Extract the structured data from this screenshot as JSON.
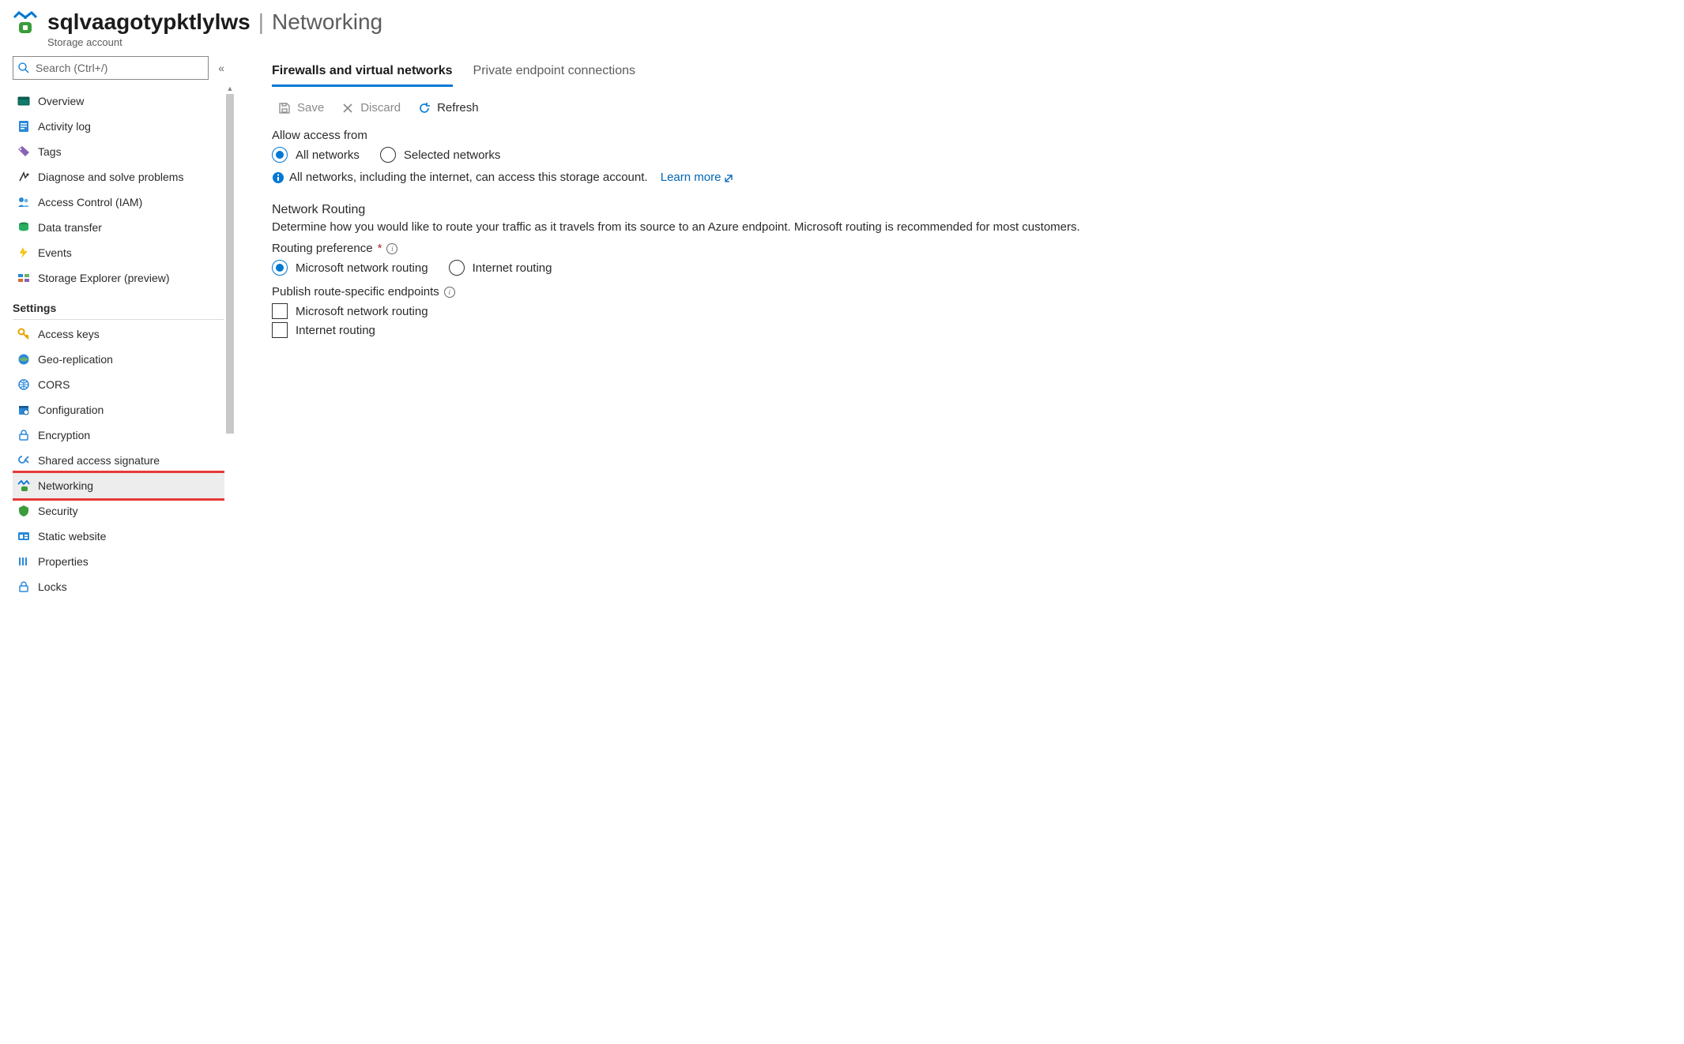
{
  "header": {
    "title": "sqlvaagotypktlylws",
    "separator": "|",
    "section": "Networking",
    "caption": "Storage account"
  },
  "search": {
    "placeholder": "Search (Ctrl+/)"
  },
  "sidebar": {
    "items": [
      {
        "label": "Overview"
      },
      {
        "label": "Activity log"
      },
      {
        "label": "Tags"
      },
      {
        "label": "Diagnose and solve problems"
      },
      {
        "label": "Access Control (IAM)"
      },
      {
        "label": "Data transfer"
      },
      {
        "label": "Events"
      },
      {
        "label": "Storage Explorer (preview)"
      }
    ],
    "settings_header": "Settings",
    "settings": [
      {
        "label": "Access keys"
      },
      {
        "label": "Geo-replication"
      },
      {
        "label": "CORS"
      },
      {
        "label": "Configuration"
      },
      {
        "label": "Encryption"
      },
      {
        "label": "Shared access signature"
      },
      {
        "label": "Networking"
      },
      {
        "label": "Security"
      },
      {
        "label": "Static website"
      },
      {
        "label": "Properties"
      },
      {
        "label": "Locks"
      }
    ]
  },
  "tabs": {
    "firewalls": "Firewalls and virtual networks",
    "private": "Private endpoint connections"
  },
  "toolbar": {
    "save": "Save",
    "discard": "Discard",
    "refresh": "Refresh"
  },
  "access": {
    "label": "Allow access from",
    "all": "All networks",
    "selected": "Selected networks"
  },
  "info": {
    "text": "All networks, including the internet, can access this storage account.",
    "link": "Learn more"
  },
  "routing": {
    "heading": "Network Routing",
    "desc": "Determine how you would like to route your traffic as it travels from its source to an Azure endpoint. Microsoft routing is recommended for most customers.",
    "pref_label": "Routing preference",
    "ms": "Microsoft network routing",
    "internet": "Internet routing",
    "publish_label": "Publish route-specific endpoints",
    "chk_ms": "Microsoft network routing",
    "chk_internet": "Internet routing"
  }
}
